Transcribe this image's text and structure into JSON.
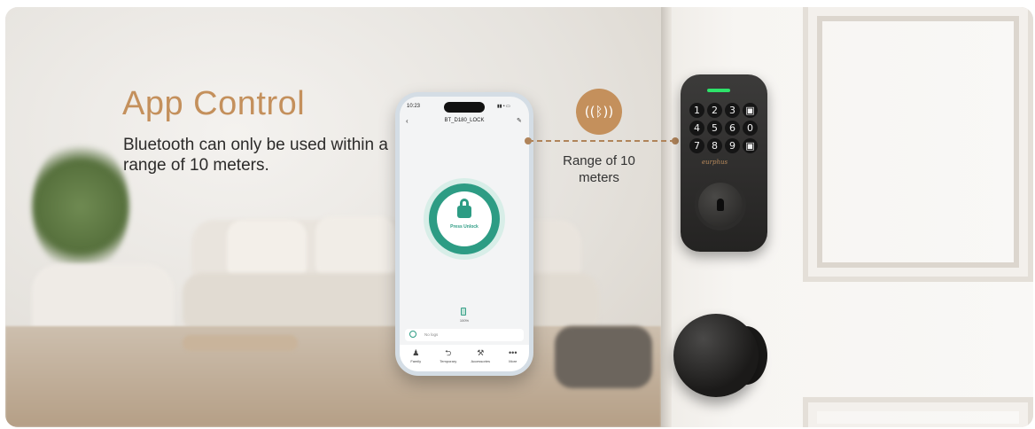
{
  "headline": "App Control",
  "description": "Bluetooth can only be used within a range of 10 meters.",
  "range_label": "Range of 10 meters",
  "accent_color": "#c4905c",
  "bluetooth_icon": "bluetooth-signal-icon",
  "phone": {
    "time": "10:23",
    "status": "▮▮ • ▭",
    "device_name": "BT_D180_LOCK",
    "unlock_label": "Press Unlock",
    "battery": "100%",
    "logs_label": "No logs",
    "tabs": [
      {
        "icon": "family-icon",
        "glyph": "♟",
        "label": "Family"
      },
      {
        "icon": "key-icon",
        "glyph": "⮌",
        "label": "Temporary"
      },
      {
        "icon": "tools-icon",
        "glyph": "⚒",
        "label": "Accessories"
      },
      {
        "icon": "more-icon",
        "glyph": "•••",
        "label": "More"
      }
    ],
    "primary_color": "#2d9c84"
  },
  "lock": {
    "keys": [
      "1",
      "2",
      "3",
      "▣",
      "4",
      "5",
      "6",
      "0",
      "7",
      "8",
      "9",
      "▣"
    ],
    "brand": "eurphus",
    "led_color": "#2ee36a"
  }
}
